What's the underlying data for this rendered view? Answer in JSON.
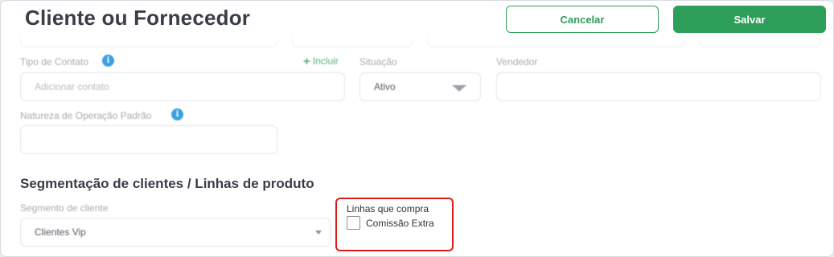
{
  "header": {
    "title": "Cliente ou Fornecedor",
    "cancel_label": "Cancelar",
    "save_label": "Salvar"
  },
  "contato": {
    "label": "Tipo de Contato",
    "add_label": "Incluir",
    "placeholder": "Adicionar contato"
  },
  "situacao": {
    "label": "Situação",
    "value": "Ativo"
  },
  "vendedor": {
    "label": "Vendedor",
    "value": ""
  },
  "natureza": {
    "label": "Natureza de Operação Padrão",
    "value": ""
  },
  "segmentacao": {
    "title": "Segmentação de clientes / Linhas de produto",
    "segmento_label": "Segmento de cliente",
    "segmento_value": "Clientes Vip",
    "linhas_label": "Linhas que compra",
    "checkbox_label": "Comissão Extra",
    "checkbox_checked": false
  },
  "colors": {
    "primary_green": "#2e9e5b",
    "info_blue": "#3aa0e0",
    "highlight_red": "#e01b1b"
  },
  "icons": {
    "info": "info-icon",
    "add": "plus-icon",
    "dropdown": "chevron-down-icon"
  }
}
